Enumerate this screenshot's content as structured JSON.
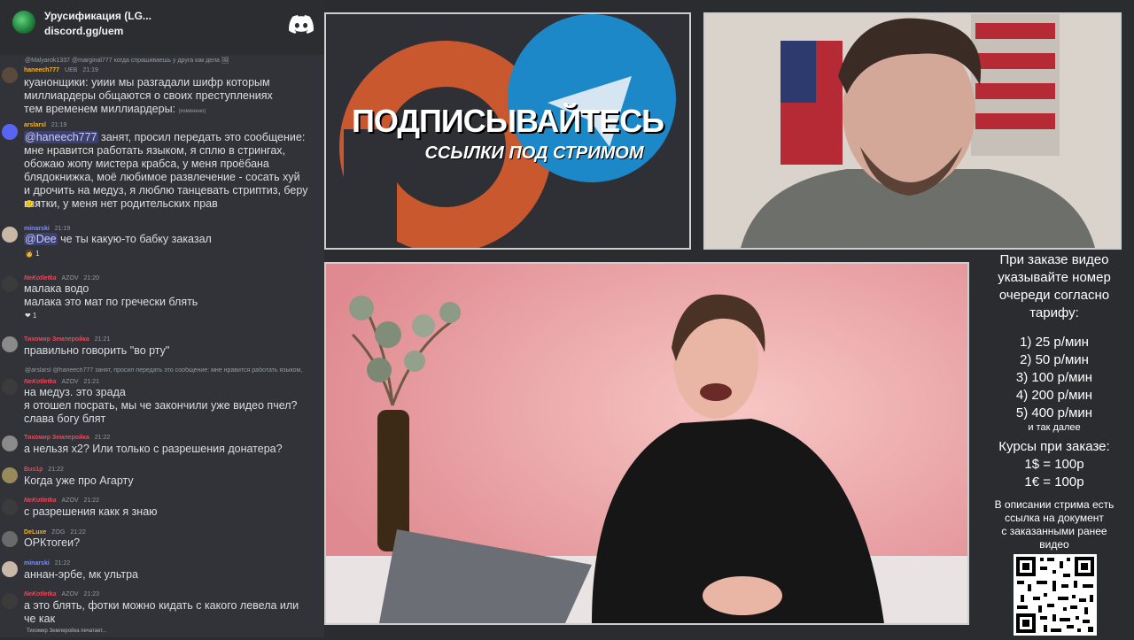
{
  "header": {
    "server_name": "Урусификация (LG...",
    "invite": "discord.gg/uem"
  },
  "messages": [
    {
      "reply": "@Malyarok1337 @marginal777 когда спрашиваешь у друга как дела 🖼",
      "user": "haneech777",
      "user_color": "#f0b232",
      "badges": "UEB",
      "time": "21:19",
      "text": "куанонщики: уиии мы разгадали шифр которым\nмиллиардеры общаются о своих преступлениях\nтем временем миллиардеры:",
      "text_suffix": "(изменено)"
    },
    {
      "user": "arslarsl",
      "user_color": "#f0b232",
      "time": "21:19",
      "mention": "@haneech777",
      "text": " занят, просил передать это сообщение:\nмне нравится работать языком, я сплю в стрингах,\nобожаю жопу мистера крабса, у меня проёбана\nблядокнижка, моё любимое развлечение - сосать хуй\nи дрочить на медуз, я люблю танцевать стриптиз, беру\nвзятки, у меня нет родительских прав",
      "reaction": "😕 2"
    },
    {
      "user": "minarski",
      "user_color": "#7f8fe8",
      "time": "21:19",
      "mention": "@Dee",
      "text": " че ты какую-то бабку заказал",
      "reaction": "👩 1"
    },
    {
      "user": "NeKotletka",
      "user_color": "#e8485a",
      "badges": "AZOV",
      "time": "21:20",
      "text": "малака водо\nмалака это мат по гречески блять",
      "reaction": "❤ 1"
    },
    {
      "user": "Тихомир Землеройка",
      "user_color": "#e8485a",
      "time": "21:21",
      "text": "правильно говорить \"во рту\""
    },
    {
      "reply": "@arslarsl @haneech777 занят, просил передать это сообщение: мне нравится работать языком,",
      "user": "NeKotletka",
      "user_color": "#e8485a",
      "badges": "AZOV",
      "time": "21:21",
      "text": "на медуз. это зрада\nя отошел посрать, мы че закончили уже видео пчел?\nслава богу блят"
    },
    {
      "user": "Тихомир Землеройка",
      "user_color": "#e8485a",
      "time": "21:22",
      "text": "а нельзя х2? Или только с разрешения донатера?"
    },
    {
      "user": "Bus1p",
      "user_color": "#e8485a",
      "time": "21:22",
      "text": "Когда уже про Агарту"
    },
    {
      "user": "NeKotletka",
      "user_color": "#e8485a",
      "badges": "AZOV",
      "time": "21:22",
      "text": "с разрешения какк я знаю"
    },
    {
      "user": "DeLuxe",
      "user_color": "#f0b232",
      "badges": "ZOG",
      "time": "21:22",
      "text": "ОРКтогеи?"
    },
    {
      "user": "minarski",
      "user_color": "#7f8fe8",
      "time": "21:22",
      "text": "аннан-эрбе, мк ультра"
    },
    {
      "user": "NeKotletka",
      "user_color": "#e8485a",
      "badges": "AZOV",
      "time": "21:23",
      "text": "а это блять, фотки можно кидать с какого левела или\nче как"
    }
  ],
  "typing": "Тихомир Землеройка печатает...",
  "promo": {
    "title": "ПОДПИСЫВАЙТЕСЬ",
    "subtitle": "ССЫЛКИ ПОД СТРИМОМ"
  },
  "info": {
    "heading": [
      "При заказе видео",
      "указывайте номер",
      "очереди согласно",
      "тарифу:"
    ],
    "prices": [
      "1) 25 р/мин",
      "2) 50 р/мин",
      "3) 100 р/мин",
      "4) 200 р/мин",
      "5) 400 р/мин"
    ],
    "etc": "и так далее",
    "rates_heading": "Курсы при заказе:",
    "rates": [
      "1$ = 100р",
      "1€ = 100р"
    ],
    "note": [
      "В описании стрима есть",
      "ссылка на документ",
      "с заказанными ранее",
      "видео"
    ]
  },
  "colors": {
    "chat_bg": "#313338",
    "mention_bg": "#5865f2",
    "panel_bg": "#2b2c30"
  }
}
